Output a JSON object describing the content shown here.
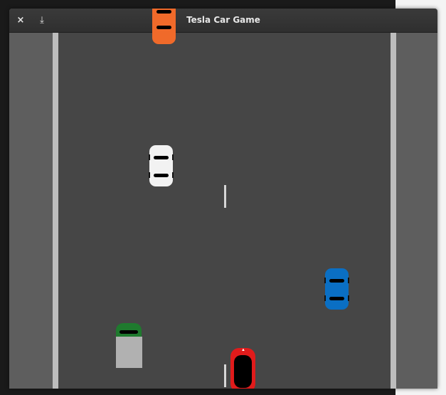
{
  "window": {
    "title": "Tesla Car Game",
    "close_icon": "×",
    "save_icon": "⤓"
  },
  "colors": {
    "road": "#464646",
    "shoulder": "#5e5e5e",
    "edge_line": "#bdbdbd",
    "lane_mark": "#d6d6d6",
    "titlebar": "#333333"
  },
  "game": {
    "player": {
      "name": "tesla",
      "color": "#e01b1b"
    },
    "traffic": [
      {
        "type": "car",
        "color": "#f06a2a"
      },
      {
        "type": "car",
        "color": "#f2f2f2"
      },
      {
        "type": "car",
        "color": "#0a6fc4"
      },
      {
        "type": "truck",
        "cab_color": "#1f7a2e",
        "trailer_color": "#b1b1b1"
      }
    ]
  }
}
